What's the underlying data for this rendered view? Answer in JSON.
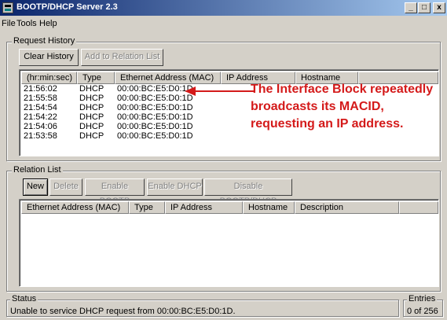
{
  "window": {
    "title": "BOOTP/DHCP Server 2.3",
    "controls": {
      "minimize": "_",
      "maximize": "□",
      "close": "x"
    }
  },
  "menu": [
    "File",
    "Tools",
    "Help"
  ],
  "request_history": {
    "label": "Request History",
    "buttons": {
      "clear": "Clear History",
      "add": "Add to Relation List"
    },
    "columns": [
      "(hr:min:sec)",
      "Type",
      "Ethernet Address (MAC)",
      "IP Address",
      "Hostname"
    ],
    "rows": [
      {
        "time": "21:56:02",
        "type": "DHCP",
        "mac": "00:00:BC:E5:D0:1D"
      },
      {
        "time": "21:55:58",
        "type": "DHCP",
        "mac": "00:00:BC:E5:D0:1D"
      },
      {
        "time": "21:54:54",
        "type": "DHCP",
        "mac": "00:00:BC:E5:D0:1D"
      },
      {
        "time": "21:54:22",
        "type": "DHCP",
        "mac": "00:00:BC:E5:D0:1D"
      },
      {
        "time": "21:54:06",
        "type": "DHCP",
        "mac": "00:00:BC:E5:D0:1D"
      },
      {
        "time": "21:53:58",
        "type": "DHCP",
        "mac": "00:00:BC:E5:D0:1D"
      }
    ],
    "annotation": [
      "The Interface Block repeatedly",
      "broadcasts its MACID,",
      "requesting an IP address."
    ],
    "annotation_color": "#d41a1a"
  },
  "relation_list": {
    "label": "Relation List",
    "buttons": {
      "new": "New",
      "delete": "Delete",
      "enable_bootp": "Enable BOOTP",
      "enable_dhcp": "Enable DHCP",
      "disable": "Disable BOOTP/DHCP"
    },
    "columns": [
      "Ethernet Address (MAC)",
      "Type",
      "IP Address",
      "Hostname",
      "Description"
    ]
  },
  "status": {
    "label": "Status",
    "text": "Unable to service DHCP request from 00:00:BC:E5:D0:1D.",
    "entries_label": "Entries",
    "entries_value": "0 of 256"
  }
}
